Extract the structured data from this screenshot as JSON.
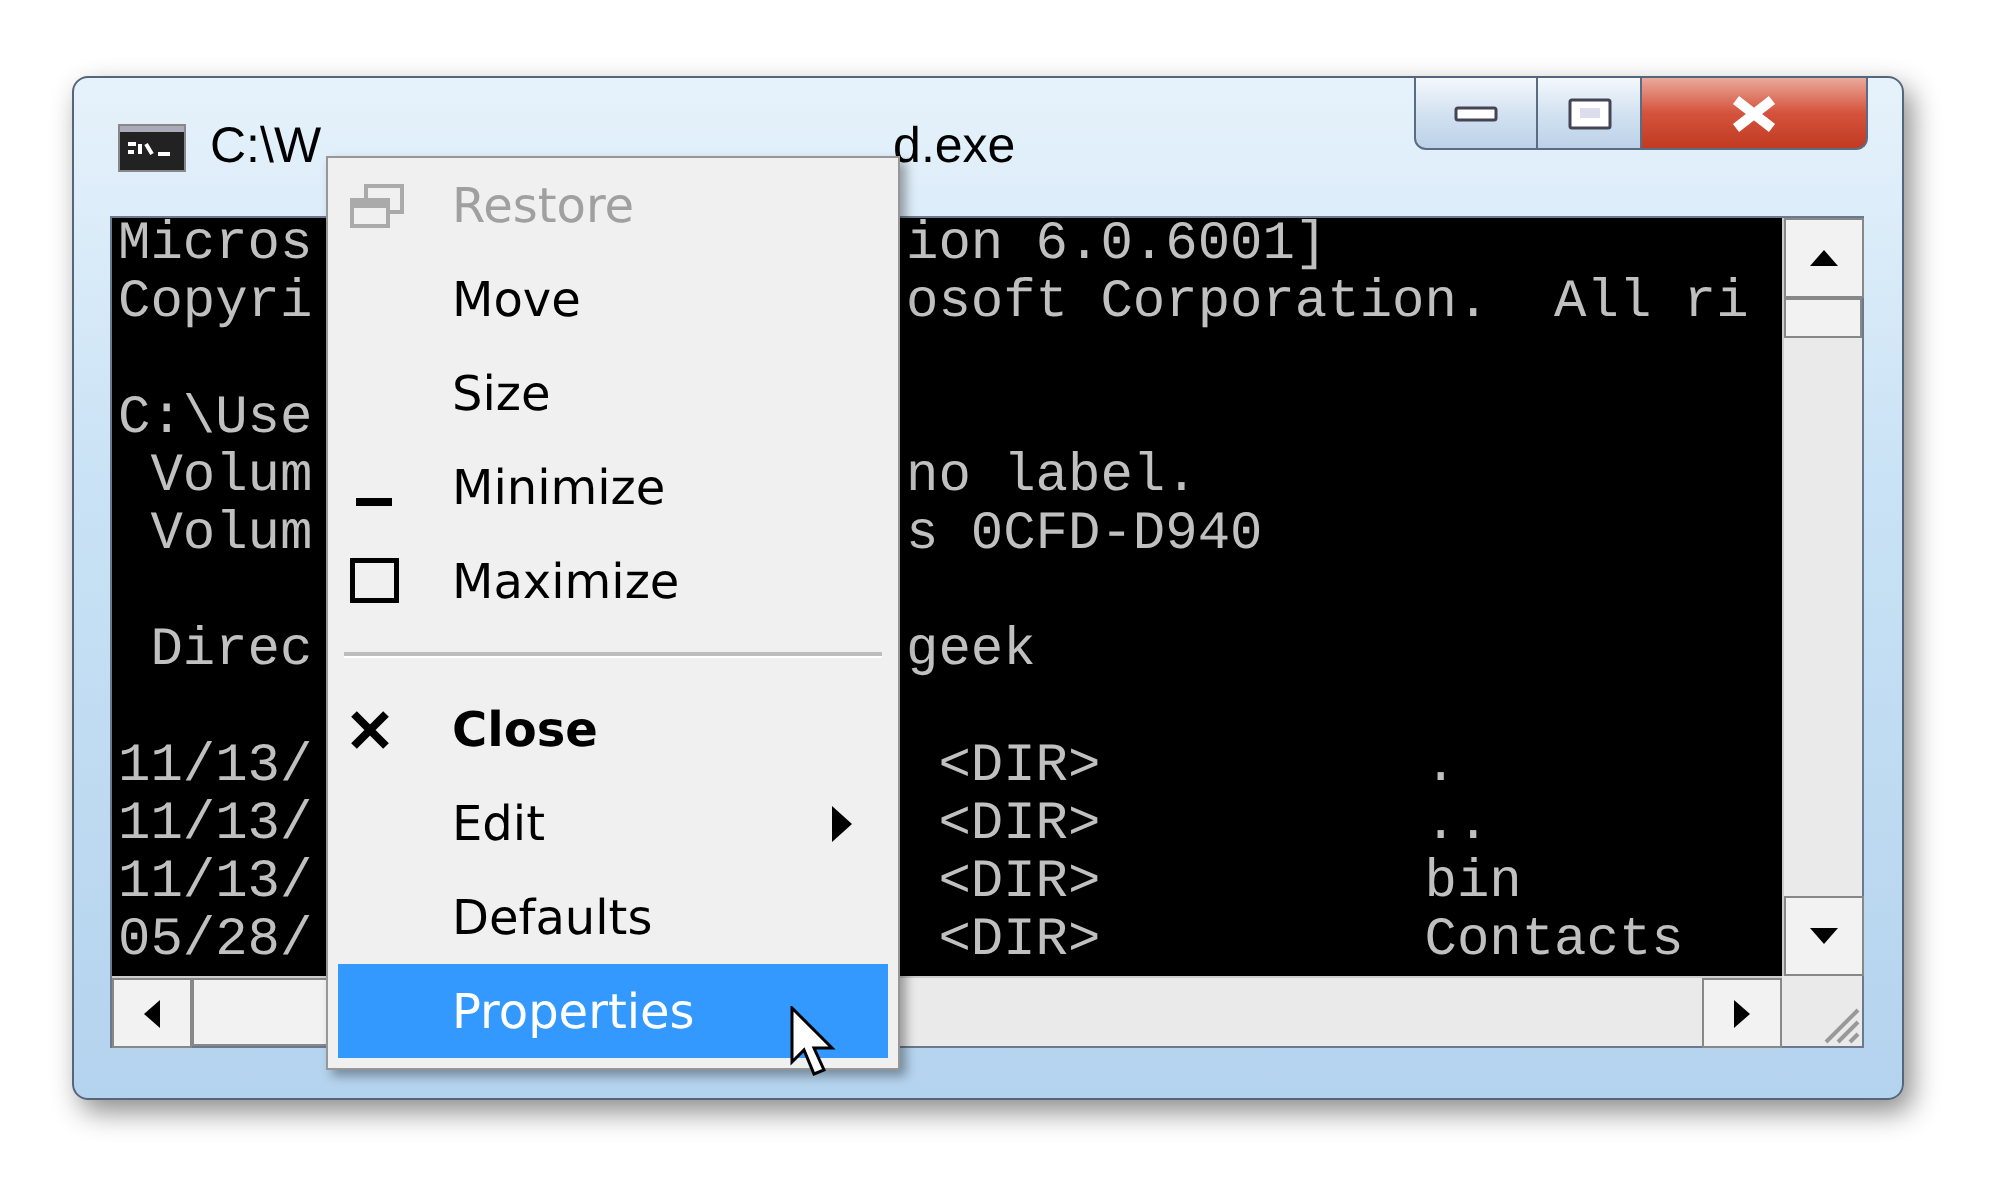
{
  "window": {
    "title_left": "C:\\W",
    "title_right": "d.exe"
  },
  "caption_buttons": [
    {
      "kind": "minimize"
    },
    {
      "kind": "maximize"
    },
    {
      "kind": "close"
    }
  ],
  "console": {
    "lines": [
      {
        "kind": "text",
        "left": "Micros",
        "right": "ion 6.0.6001]"
      },
      {
        "kind": "text",
        "left": "Copyri",
        "right": "osoft Corporation.  All ri"
      },
      {
        "kind": "blank"
      },
      {
        "kind": "text",
        "left": "C:\\Use"
      },
      {
        "kind": "text",
        "left": " Volum",
        "right": "no label."
      },
      {
        "kind": "text",
        "left": " Volum",
        "right": "s 0CFD-D940"
      },
      {
        "kind": "blank"
      },
      {
        "kind": "text",
        "left": " Direc",
        "right": "geek"
      },
      {
        "kind": "blank"
      },
      {
        "kind": "text",
        "left": "11/13/",
        "right": " <DIR>          ."
      },
      {
        "kind": "text",
        "left": "11/13/",
        "right": " <DIR>          .."
      },
      {
        "kind": "text",
        "left": "11/13/",
        "right": " <DIR>          bin"
      },
      {
        "kind": "text",
        "left": "05/28/",
        "right": " <DIR>          Contacts"
      }
    ]
  },
  "system_menu": {
    "items": [
      {
        "kind": "item",
        "label": "Restore",
        "disabled": true,
        "default": false,
        "submenu": false,
        "selected": false
      },
      {
        "kind": "item",
        "label": "Move",
        "disabled": false,
        "default": false,
        "submenu": false,
        "selected": false
      },
      {
        "kind": "item",
        "label": "Size",
        "disabled": false,
        "default": false,
        "submenu": false,
        "selected": false
      },
      {
        "kind": "item",
        "label": "Minimize",
        "disabled": false,
        "default": false,
        "submenu": false,
        "selected": false
      },
      {
        "kind": "item",
        "label": "Maximize",
        "disabled": false,
        "default": false,
        "submenu": false,
        "selected": false
      },
      {
        "kind": "separator"
      },
      {
        "kind": "item",
        "label": "Close",
        "disabled": false,
        "default": true,
        "submenu": false,
        "selected": false
      },
      {
        "kind": "item",
        "label": "Edit",
        "disabled": false,
        "default": false,
        "submenu": true,
        "selected": false
      },
      {
        "kind": "item",
        "label": "Defaults",
        "disabled": false,
        "default": false,
        "submenu": false,
        "selected": false
      },
      {
        "kind": "item",
        "label": "Properties",
        "disabled": false,
        "default": false,
        "submenu": false,
        "selected": true
      }
    ]
  }
}
